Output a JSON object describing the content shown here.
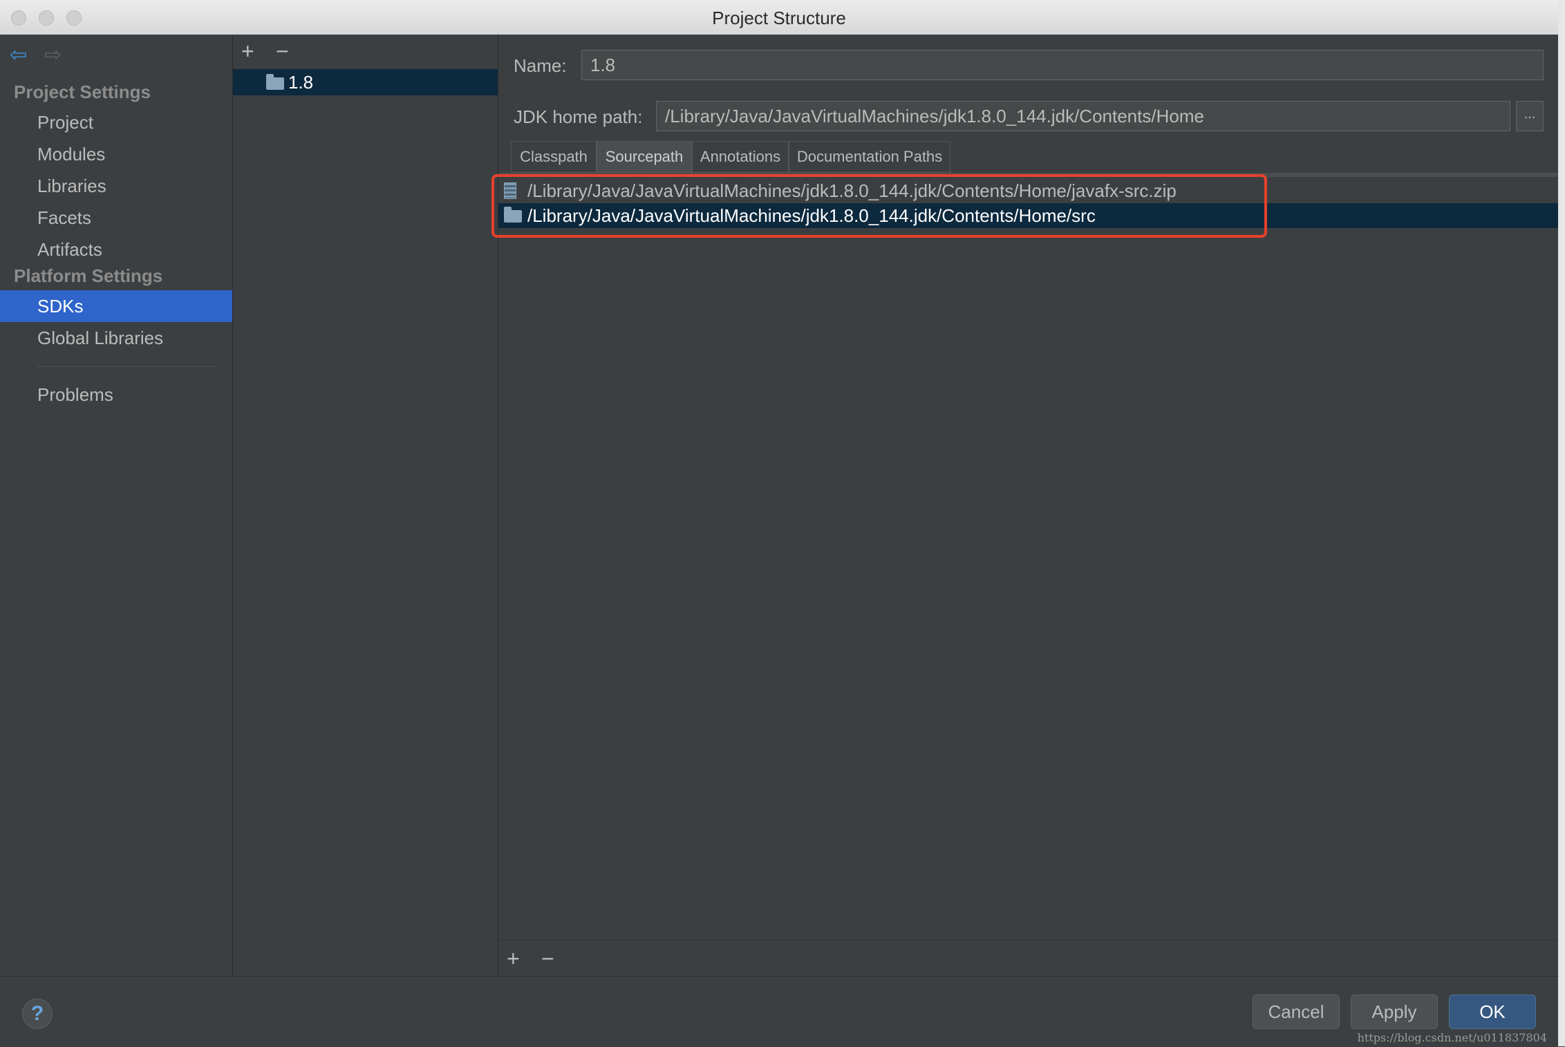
{
  "window": {
    "title": "Project Structure"
  },
  "nav": {
    "project_settings_header": "Project Settings",
    "project_items": [
      "Project",
      "Modules",
      "Libraries",
      "Facets",
      "Artifacts"
    ],
    "platform_settings_header": "Platform Settings",
    "platform_items": [
      "SDKs",
      "Global Libraries"
    ],
    "selected": "SDKs",
    "problems": "Problems"
  },
  "sdk_list": {
    "items": [
      "1.8"
    ],
    "add_icon": "+",
    "remove_icon": "−"
  },
  "sdk": {
    "name_label": "Name:",
    "name_value": "1.8",
    "home_label": "JDK home path:",
    "home_value": "/Library/Java/JavaVirtualMachines/jdk1.8.0_144.jdk/Contents/Home",
    "browse_label": "...",
    "tabs": [
      "Classpath",
      "Sourcepath",
      "Annotations",
      "Documentation Paths"
    ],
    "active_tab": "Sourcepath",
    "paths": [
      "/Library/Java/JavaVirtualMachines/jdk1.8.0_144.jdk/Contents/Home/javafx-src.zip",
      "/Library/Java/JavaVirtualMachines/jdk1.8.0_144.jdk/Contents/Home/src"
    ],
    "add_icon": "+",
    "remove_icon": "−"
  },
  "footer": {
    "help": "?",
    "cancel": "Cancel",
    "apply": "Apply",
    "ok": "OK",
    "watermark": "https://blog.csdn.net/u011837804"
  },
  "colors": {
    "selection": "#2f65ca",
    "row_selection": "#0d293e",
    "highlight": "#e8412c"
  }
}
